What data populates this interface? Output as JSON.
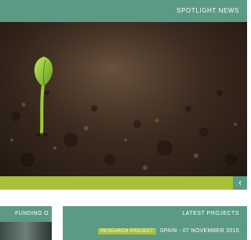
{
  "header": {
    "title": "SPOTLIGHT NEWS"
  },
  "hero": {
    "image_alt": "seedling sprouting from soil"
  },
  "carousel": {
    "nav_icon": "chevron-left-icon",
    "nav_glyph": "‹"
  },
  "funding": {
    "title": "FUNDING O"
  },
  "projects": {
    "title": "LATEST PROJECTS",
    "items": [
      {
        "location_date": "SPAIN - 07 NOVEMBER 2015",
        "tag": "RESEARCH PROJECT"
      }
    ]
  },
  "colors": {
    "teal": "#5c9a86",
    "lime": "#a8c03a"
  }
}
